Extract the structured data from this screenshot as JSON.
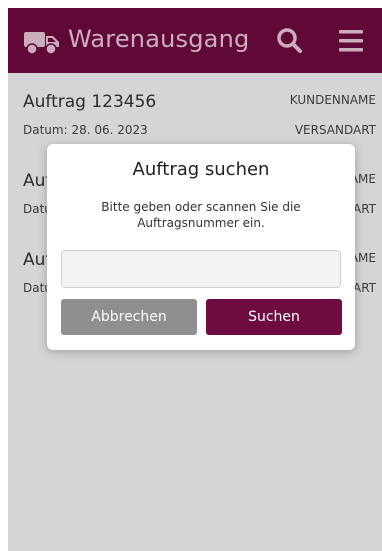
{
  "header": {
    "title": "Warenausgang",
    "icons": [
      "truck-icon",
      "search-icon",
      "menu-icon"
    ],
    "background": "#6e0b40"
  },
  "orders": [
    {
      "title": "Auftrag 123456",
      "date": "Datum: 28. 06. 2023",
      "customer": "KUNDENNAME",
      "shipping": "VERSANDART"
    },
    {
      "title": "Auftrag 123456",
      "date": "Datum: 28. 06. 2023",
      "customer": "KUNDENNAME",
      "shipping": "VERSANDART"
    },
    {
      "title": "Auftrag 123456",
      "date": "Datum: 28. 06. 2023",
      "customer": "KUNDENNAME",
      "shipping": "VERSANDART"
    }
  ],
  "dialog": {
    "title": "Auftrag suchen",
    "message": "Bitte geben oder scannen Sie die Auftragsnummer ein.",
    "input_value": "",
    "cancel_label": "Abbrechen",
    "search_label": "Suchen"
  },
  "colors": {
    "accent": "#6e0b40",
    "cancel": "#8f8f8f",
    "title_text": "#e9c5d6"
  }
}
